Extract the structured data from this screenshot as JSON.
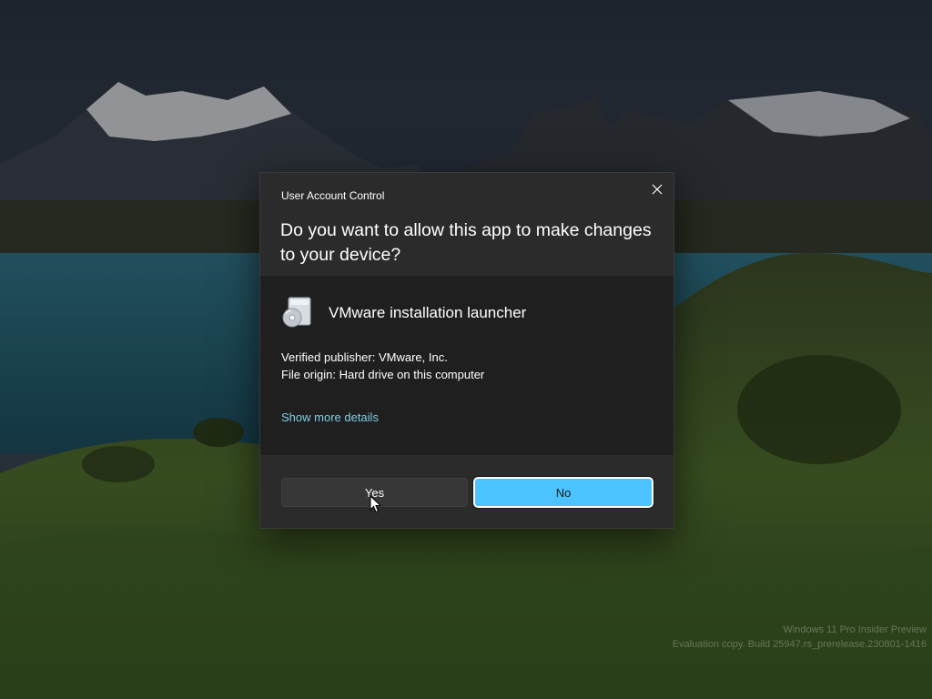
{
  "uac": {
    "caption": "User Account Control",
    "question": "Do you want to allow this app to make changes to your device?",
    "app_name": "VMware installation launcher",
    "publisher": "Verified publisher: VMware, Inc.",
    "origin": "File origin: Hard drive on this computer",
    "details_link": "Show more details",
    "yes_label": "Yes",
    "no_label": "No",
    "app_icon": "installer-disc-icon",
    "close_icon": "close-icon"
  },
  "watermark": {
    "line1": "Windows 11 Pro Insider Preview",
    "line2": "Evaluation copy. Build 25947.rs_prerelease.230801-1416"
  },
  "colors": {
    "accent": "#4cc2ff",
    "link": "#7ecfe6",
    "dialog_bg": "#2b2b2b",
    "dialog_body_bg": "#1f1f1f"
  }
}
